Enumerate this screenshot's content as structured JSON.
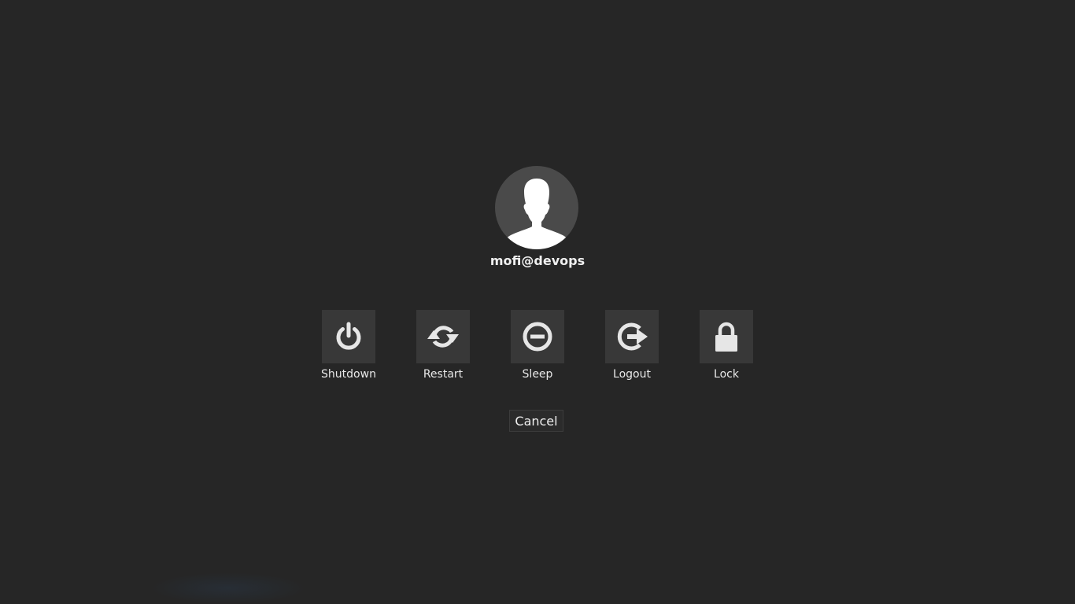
{
  "user": {
    "name": "mofi@devops",
    "avatar_icon": "user-silhouette-icon"
  },
  "actions": [
    {
      "id": "shutdown",
      "label": "Shutdown",
      "icon": "power-icon"
    },
    {
      "id": "restart",
      "label": "Restart",
      "icon": "refresh-icon"
    },
    {
      "id": "sleep",
      "label": "Sleep",
      "icon": "minus-circle-icon"
    },
    {
      "id": "logout",
      "label": "Logout",
      "icon": "logout-arrow-icon"
    },
    {
      "id": "lock",
      "label": "Lock",
      "icon": "lock-icon"
    }
  ],
  "cancel_label": "Cancel",
  "colors": {
    "background": "#262626",
    "tile": "#383838",
    "icon": "#e6e6e6",
    "avatar_bg": "#4a4a4a"
  }
}
